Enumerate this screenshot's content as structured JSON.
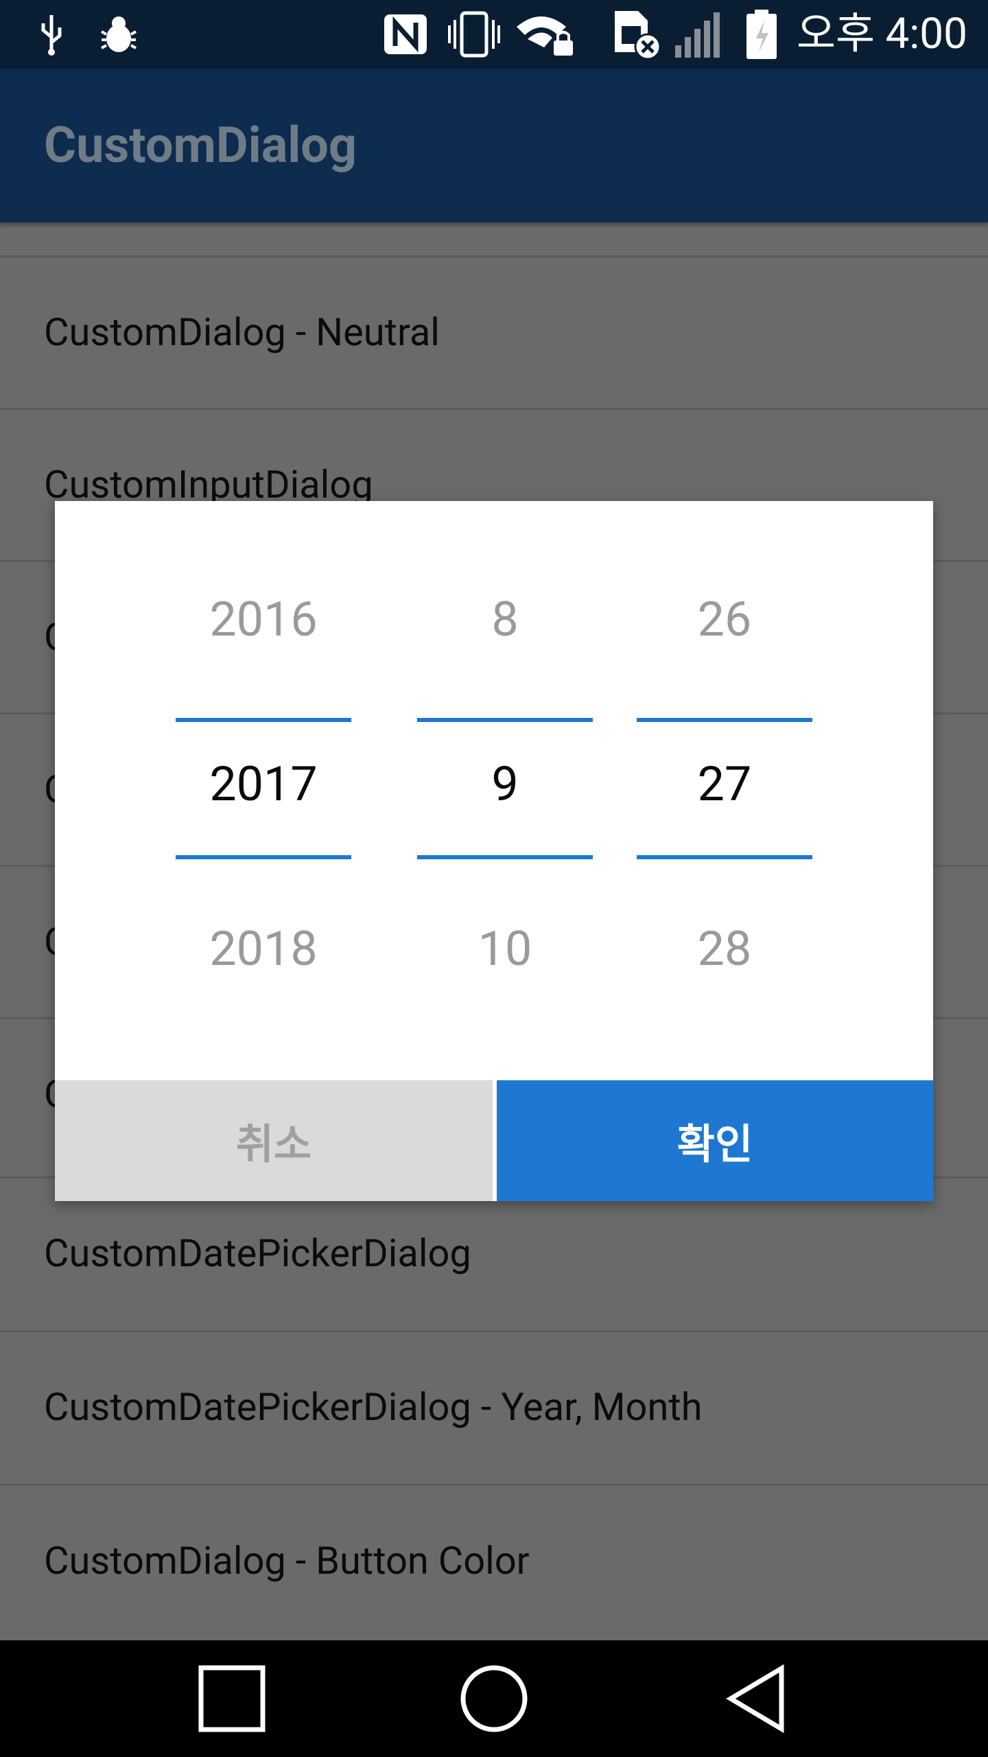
{
  "status_bar": {
    "time": "오후 4:00",
    "icons": [
      "usb-icon",
      "bug-icon",
      "nfc-icon",
      "vibrate-icon",
      "wifi-lock-icon",
      "sim-error-icon",
      "signal-icon",
      "battery-icon"
    ]
  },
  "app_bar": {
    "title": "CustomDialog"
  },
  "list": {
    "items": [
      {
        "label": "CustomDialog - Neutral"
      },
      {
        "label": "CustomInputDialog"
      },
      {
        "label": "C"
      },
      {
        "label": "C"
      },
      {
        "label": "C"
      },
      {
        "label": "C"
      },
      {
        "label": "CustomDatePickerDialog"
      },
      {
        "label": "CustomDatePickerDialog - Year, Month"
      },
      {
        "label": "CustomDialog - Button Color"
      }
    ]
  },
  "dialog": {
    "year": {
      "prev": "2016",
      "selected": "2017",
      "next": "2018"
    },
    "month": {
      "prev": "8",
      "selected": "9",
      "next": "10"
    },
    "day": {
      "prev": "26",
      "selected": "27",
      "next": "28"
    },
    "cancel_label": "취소",
    "ok_label": "확인"
  },
  "colors": {
    "accent": "#1e78d2",
    "app_bar": "#0d2c4f",
    "status_bar": "#0a1e33"
  },
  "nav_bar": {
    "icons": [
      "recent-apps-icon",
      "home-icon",
      "back-icon"
    ]
  }
}
